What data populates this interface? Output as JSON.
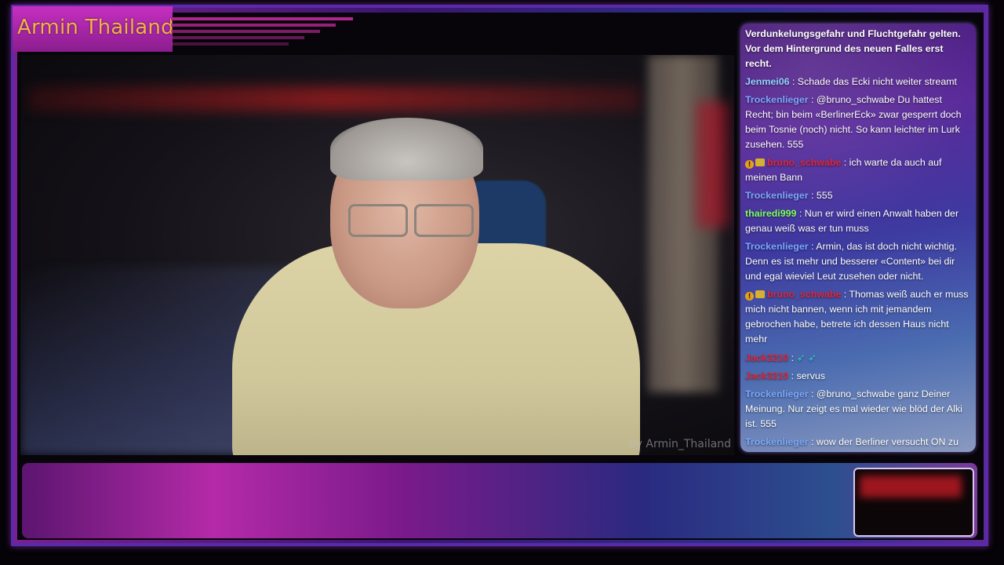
{
  "stream": {
    "title": "Armin Thailand",
    "watermark": "by Armin_Thailand"
  },
  "chat": {
    "messages": [
      {
        "user": "",
        "user_color": "#ffffff",
        "badges": 0,
        "text": "Verdunkelungsgefahr und Fluchtgefahr gelten. Vor dem Hintergrund des neuen Falles erst recht."
      },
      {
        "user": "Jenmei06",
        "user_color": "#8fd3ff",
        "badges": 0,
        "text": ": Schade das Ecki nicht weiter streamt"
      },
      {
        "user": "Trockenlieger",
        "user_color": "#7aa8ff",
        "badges": 0,
        "text": ": @bruno_schwabe Du hattest Recht; bin beim «BerlinerEck» zwar gesperrt doch beim Tosnie (noch) nicht. So kann leichter im Lurk zusehen. 555"
      },
      {
        "user": "bruno_schwabe",
        "user_color": "#e0263a",
        "badges": 2,
        "text": ": ich warte da auch auf meinen Bann"
      },
      {
        "user": "Trockenlieger",
        "user_color": "#7aa8ff",
        "badges": 0,
        "text": ": 555"
      },
      {
        "user": "thairedi999",
        "user_color": "#7cff5c",
        "badges": 0,
        "text": ": Nun er wird einen Anwalt haben der genau weiß was er tun muss"
      },
      {
        "user": "Trockenlieger",
        "user_color": "#7aa8ff",
        "badges": 0,
        "text": ": Armin, das ist doch nicht wichtig. Denn es ist mehr und besserer «Content» bei dir und egal wieviel Leut zusehen oder nicht."
      },
      {
        "user": "bruno_schwabe",
        "user_color": "#e0263a",
        "badges": 2,
        "text": ": Thomas weiß auch er muss mich nicht bannen, wenn ich mit jemandem gebrochen habe, betrete ich dessen Haus nicht mehr"
      },
      {
        "user": "Jack3210",
        "user_color": "#e0263a",
        "badges": 0,
        "text": ":",
        "emotes": "➶ ➶"
      },
      {
        "user": "Jack3210",
        "user_color": "#e0263a",
        "badges": 0,
        "text": ": servus"
      },
      {
        "user": "Trockenlieger",
        "user_color": "#7aa8ff",
        "badges": 0,
        "text": ": @bruno_schwabe ganz Deiner Meinung. Nur zeigt es mal wieder wie blöd der Alki ist. 555"
      },
      {
        "user": "Trockenlieger",
        "user_color": "#7aa8ff",
        "badges": 0,
        "text": ": wow der Berliner versucht ON zu gehen"
      }
    ]
  },
  "colors": {
    "title_text": "#f2b24a",
    "frame_purple": "#5a2aa8",
    "accent_magenta": "#b42aa8"
  },
  "icons": {
    "badge_info": "info-badge-icon",
    "badge_sub": "subscriber-badge-icon",
    "emote": "arrow-emote-icon"
  }
}
